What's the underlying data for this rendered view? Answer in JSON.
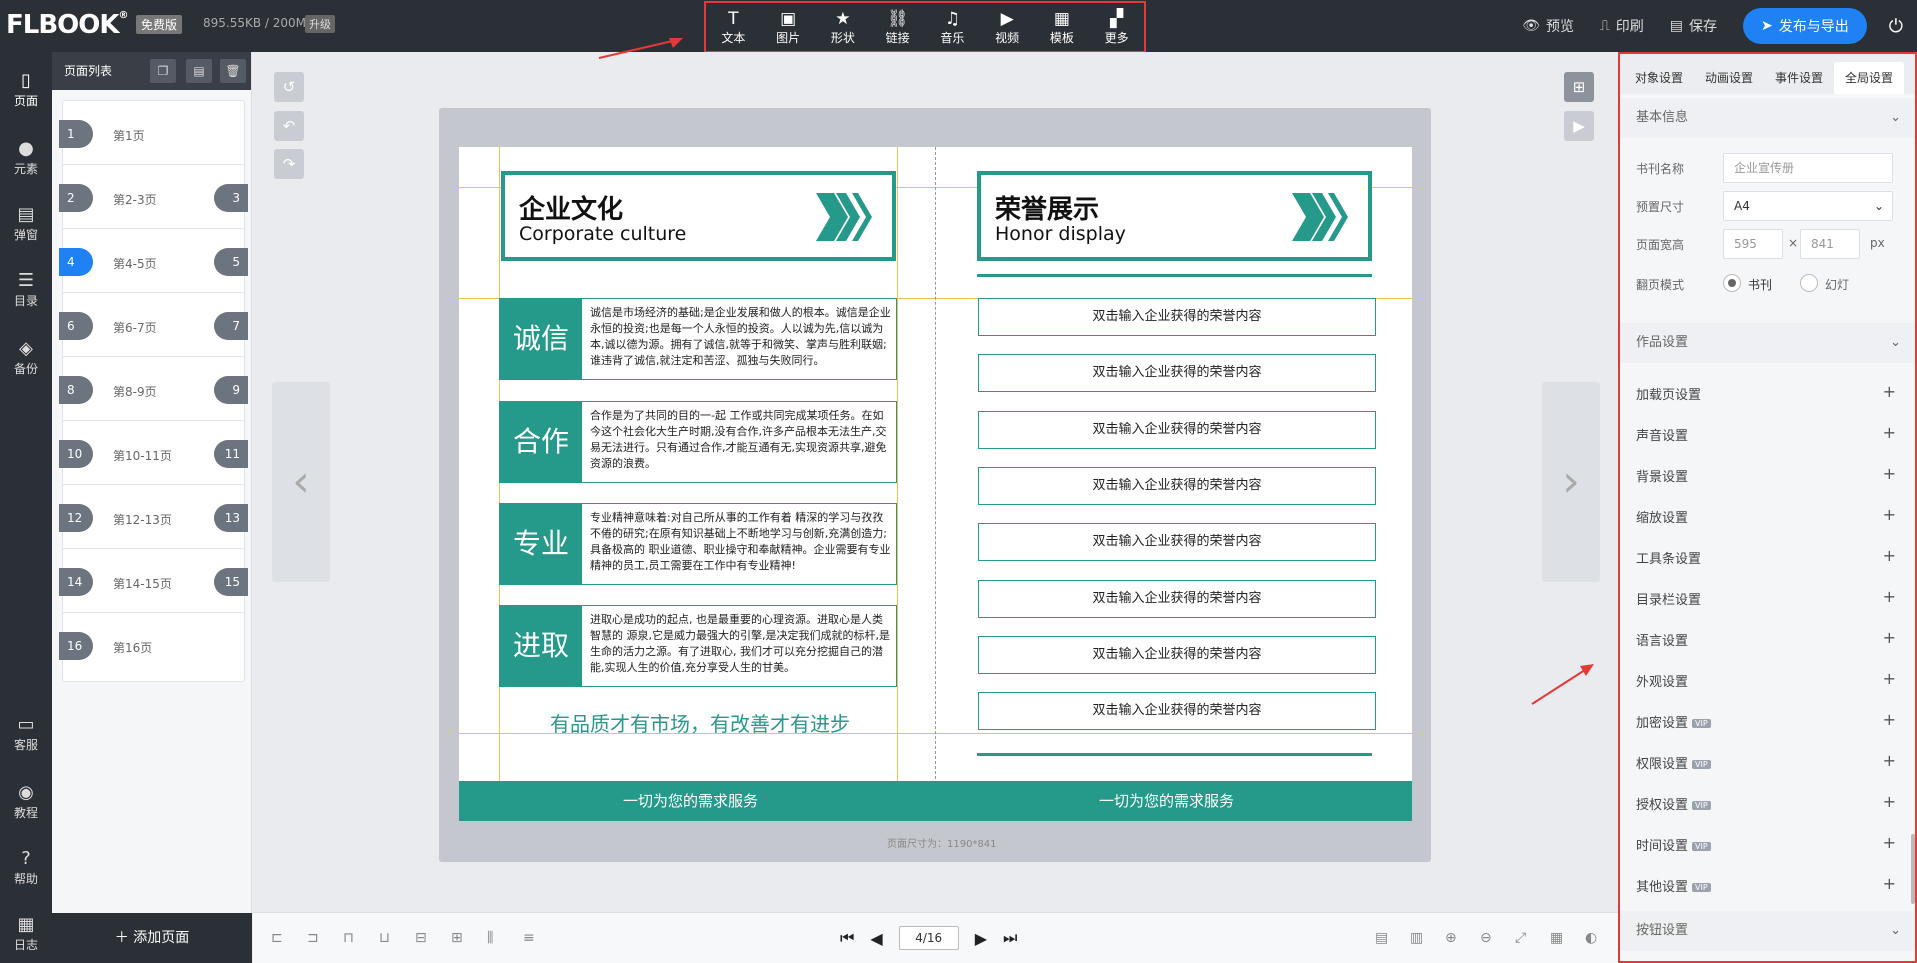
{
  "app": {
    "logo": "FLBOOK",
    "plan_badge": "免费版",
    "storage": "895.55KB / 200M",
    "upgrade": "升级"
  },
  "toolbar": {
    "items": [
      {
        "label": "文本",
        "icon": "T"
      },
      {
        "label": "图片",
        "icon": "▣"
      },
      {
        "label": "形状",
        "icon": "★"
      },
      {
        "label": "链接",
        "icon": "⛓"
      },
      {
        "label": "音乐",
        "icon": "♫"
      },
      {
        "label": "视频",
        "icon": "▶"
      },
      {
        "label": "模板",
        "icon": "▦"
      },
      {
        "label": "更多",
        "icon": "▞"
      }
    ]
  },
  "top_actions": {
    "preview": "预览",
    "print": "印刷",
    "save": "保存",
    "publish": "发布与导出"
  },
  "rail": {
    "items": [
      "页面",
      "元素",
      "弹窗",
      "目录",
      "备份"
    ],
    "bottom_items": [
      "客服",
      "教程",
      "帮助",
      "日志"
    ]
  },
  "page_list": {
    "title": "页面列表",
    "add_page": "添加页面",
    "pages": [
      {
        "label": "第1页",
        "left": "1",
        "right": ""
      },
      {
        "label": "第2-3页",
        "left": "2",
        "right": "3"
      },
      {
        "label": "第4-5页",
        "left": "4",
        "right": "5",
        "active": true
      },
      {
        "label": "第6-7页",
        "left": "6",
        "right": "7"
      },
      {
        "label": "第8-9页",
        "left": "8",
        "right": "9"
      },
      {
        "label": "第10-11页",
        "left": "10",
        "right": "11"
      },
      {
        "label": "第12-13页",
        "left": "12",
        "right": "13"
      },
      {
        "label": "第14-15页",
        "left": "14",
        "right": "15"
      },
      {
        "label": "第16页",
        "left": "16",
        "right": ""
      }
    ]
  },
  "book": {
    "left_title": "企业文化",
    "left_subtitle": "Corporate culture",
    "right_title": "荣誉展示",
    "right_subtitle": "Honor display",
    "values": [
      {
        "tag": "诚信",
        "text": "诚信是市场经济的基础;是企业发展和做人的根本。诚信是企业永恒的投资;也是每一个人永恒的投资。人以诚为先,信以诚为本,诚以德为源。拥有了诚信,就等于和微笑、掌声与胜利联姻;谁违背了诚信,就注定和苦涩、孤独与失败同行。"
      },
      {
        "tag": "合作",
        "text": "合作是为了共同的目的一-起 工作或共同完成某项任务。在如今这个社会化大生产时期,没有合作,许多产品根本无法生产,交易无法进行。只有通过合作,才能互通有无,实现资源共享,避免资源的浪费。"
      },
      {
        "tag": "专业",
        "text": "专业精神意味着:对自己所从事的工作有着 精深的学习与孜孜不倦的研究;在原有知识基础上不断地学习与创新,充满创造力;具备极高的 职业道德、职业操守和奉献精神。企业需要有专业精神的员工,员工需要在工作中有专业精神!"
      },
      {
        "tag": "进取",
        "text": "进取心是成功的起点, 也是最重要的心理资源。进取心是人类智慧的 源泉,它是威力最强大的引擎,是决定我们成就的标杆,是生命的活力之源。有了进取心, 我们才可以充分挖掘自己的潜能,实现人生的价值,充分享受人生的甘美。"
      }
    ],
    "slogan": "有品质才有市场，有改善才有进步",
    "honor_item": "双击输入企业获得的荣誉内容",
    "honor_count": 8,
    "footer_left": "一切为您的需求服务",
    "footer_right": "一切为您的需求服务",
    "page_size_label": "页面尺寸为：1190*841"
  },
  "pager": {
    "current": "4/16"
  },
  "right_panel": {
    "tabs": [
      "对象设置",
      "动画设置",
      "事件设置",
      "全局设置"
    ],
    "active_tab": 3,
    "basic_info": "基本信息",
    "book_name_label": "书刊名称",
    "book_name_placeholder": "企业宣传册",
    "preset_size_label": "预置尺寸",
    "preset_size_value": "A4",
    "page_wh_label": "页面宽高",
    "width": "595",
    "height": "841",
    "times": "×",
    "unit": "px",
    "flip_mode_label": "翻页模式",
    "flip_book": "书刊",
    "flip_slide": "幻灯",
    "work_settings": "作品设置",
    "settings": [
      {
        "label": "加载页设置",
        "vip": false
      },
      {
        "label": "声音设置",
        "vip": false
      },
      {
        "label": "背景设置",
        "vip": false
      },
      {
        "label": "缩放设置",
        "vip": false
      },
      {
        "label": "工具条设置",
        "vip": false
      },
      {
        "label": "目录栏设置",
        "vip": false
      },
      {
        "label": "语言设置",
        "vip": false
      },
      {
        "label": "外观设置",
        "vip": false
      },
      {
        "label": "加密设置",
        "vip": true
      },
      {
        "label": "权限设置",
        "vip": true
      },
      {
        "label": "授权设置",
        "vip": true
      },
      {
        "label": "时间设置",
        "vip": true
      },
      {
        "label": "其他设置",
        "vip": true
      }
    ],
    "vip_badge": "VIP",
    "button_settings": "按钮设置"
  },
  "colors": {
    "teal": "#259a8a",
    "dark": "#2b2f36",
    "accent": "#1e82f5",
    "highlight": "#e53935"
  }
}
